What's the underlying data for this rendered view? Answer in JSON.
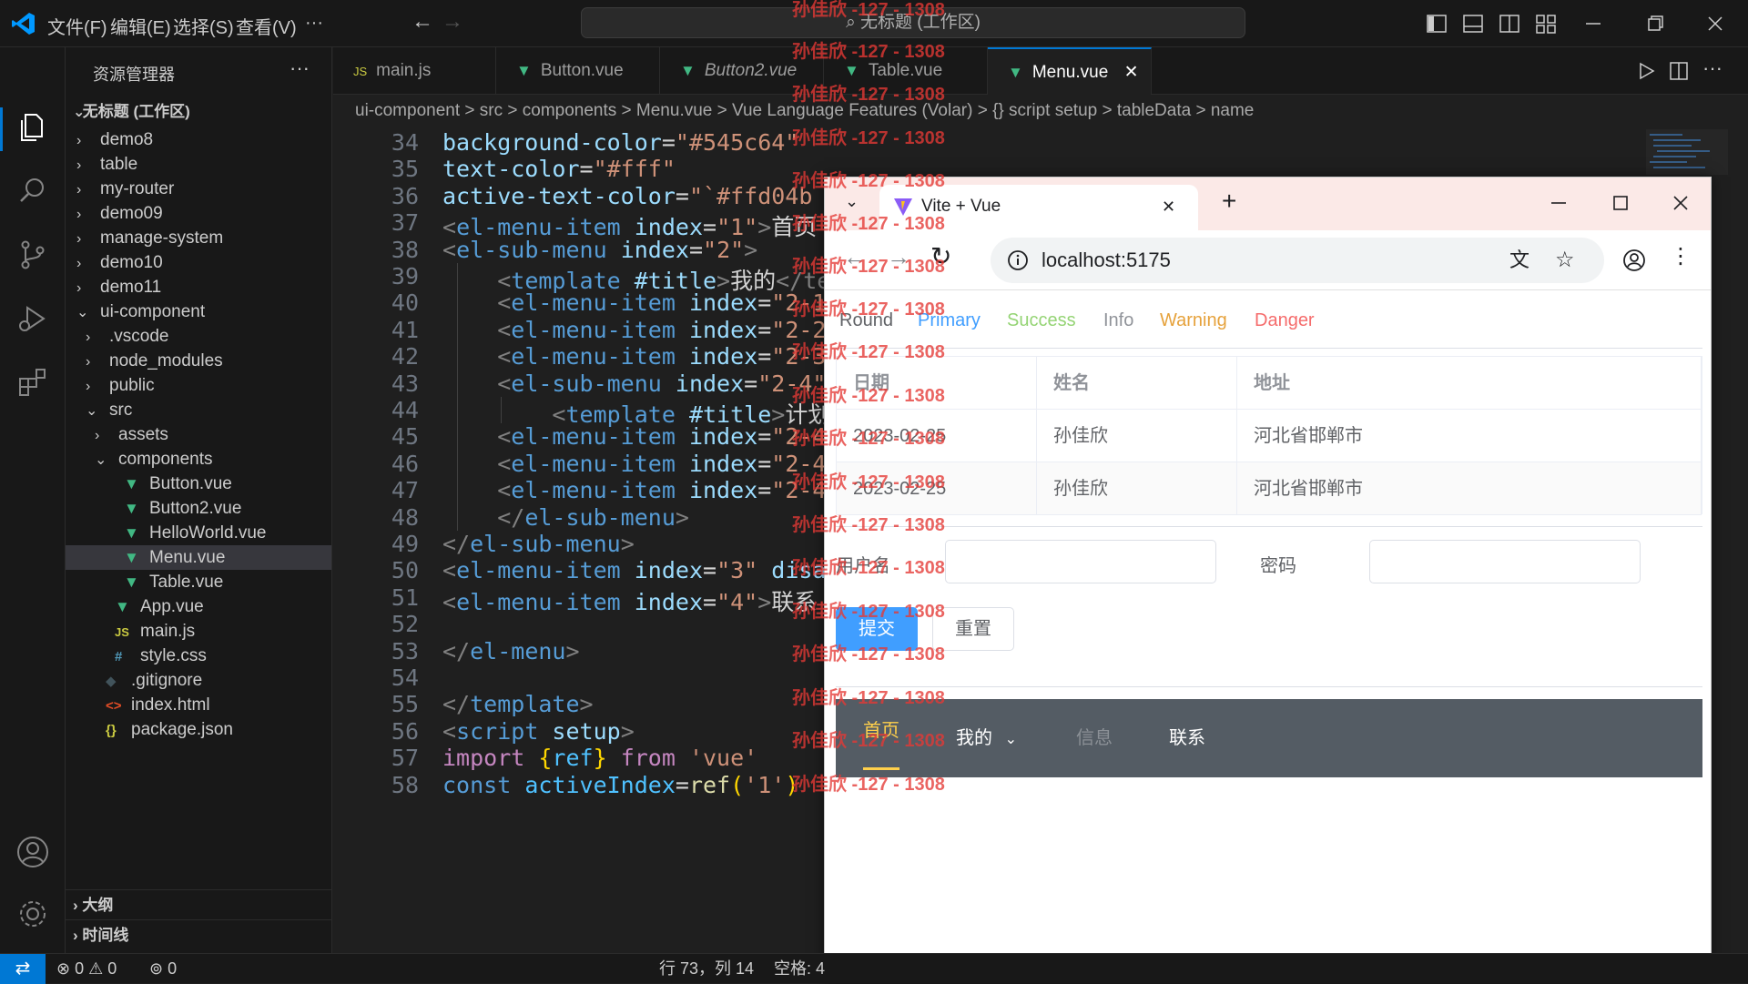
{
  "titlebar": {
    "menus": [
      "文件(F)",
      "编辑(E)",
      "选择(S)",
      "查看(V)",
      "···"
    ],
    "search": "无标题 (工作区)"
  },
  "sidebar": {
    "title": "资源管理器",
    "more": "···",
    "workspace": "无标题 (工作区)",
    "items": [
      {
        "label": "demo8",
        "depth": 0,
        "type": "folder",
        "expanded": false
      },
      {
        "label": "table",
        "depth": 0,
        "type": "folder",
        "expanded": false
      },
      {
        "label": "my-router",
        "depth": 0,
        "type": "folder",
        "expanded": false
      },
      {
        "label": "demo09",
        "depth": 0,
        "type": "folder",
        "expanded": false
      },
      {
        "label": "manage-system",
        "depth": 0,
        "type": "folder",
        "expanded": false
      },
      {
        "label": "demo10",
        "depth": 0,
        "type": "folder",
        "expanded": false
      },
      {
        "label": "demo11",
        "depth": 0,
        "type": "folder",
        "expanded": false
      },
      {
        "label": "ui-component",
        "depth": 0,
        "type": "folder",
        "expanded": true
      },
      {
        "label": ".vscode",
        "depth": 1,
        "type": "folder",
        "expanded": false
      },
      {
        "label": "node_modules",
        "depth": 1,
        "type": "folder",
        "expanded": false
      },
      {
        "label": "public",
        "depth": 1,
        "type": "folder",
        "expanded": false
      },
      {
        "label": "src",
        "depth": 1,
        "type": "folder",
        "expanded": true
      },
      {
        "label": "assets",
        "depth": 2,
        "type": "folder",
        "expanded": false
      },
      {
        "label": "components",
        "depth": 2,
        "type": "folder",
        "expanded": true
      },
      {
        "label": "Button.vue",
        "depth": 3,
        "type": "vue"
      },
      {
        "label": "Button2.vue",
        "depth": 3,
        "type": "vue"
      },
      {
        "label": "HelloWorld.vue",
        "depth": 3,
        "type": "vue"
      },
      {
        "label": "Menu.vue",
        "depth": 3,
        "type": "vue",
        "selected": true
      },
      {
        "label": "Table.vue",
        "depth": 3,
        "type": "vue"
      },
      {
        "label": "App.vue",
        "depth": 2,
        "type": "vue"
      },
      {
        "label": "main.js",
        "depth": 2,
        "type": "js"
      },
      {
        "label": "style.css",
        "depth": 2,
        "type": "css"
      },
      {
        "label": ".gitignore",
        "depth": 1,
        "type": "git"
      },
      {
        "label": "index.html",
        "depth": 1,
        "type": "html"
      },
      {
        "label": "package.json",
        "depth": 1,
        "type": "json"
      }
    ],
    "outline": "大纲",
    "timeline": "时间线"
  },
  "tabs": [
    {
      "label": "main.js",
      "icon": "JS",
      "italic": false,
      "active": false
    },
    {
      "label": "Button.vue",
      "icon": "V",
      "italic": false,
      "active": false
    },
    {
      "label": "Button2.vue",
      "icon": "V",
      "italic": true,
      "active": false
    },
    {
      "label": "Table.vue",
      "icon": "V",
      "italic": false,
      "active": false
    },
    {
      "label": "Menu.vue",
      "icon": "V",
      "italic": false,
      "active": true
    }
  ],
  "breadcrumb": "ui-component > src > components > Menu.vue > Vue Language Features (Volar) > {} script setup > tableData > name",
  "code": {
    "line_numbers": [
      "34",
      "35",
      "36",
      "37",
      "38",
      "39",
      "40",
      "41",
      "42",
      "43",
      "44",
      "45",
      "46",
      "47",
      "48",
      "49",
      "50",
      "51",
      "52",
      "53",
      "54",
      "55",
      "56",
      "57",
      "58"
    ],
    "lines": [
      [
        [
          "background-color",
          "attr"
        ],
        [
          "=",
          "txt"
        ],
        [
          "\"#545c64\"",
          "str"
        ]
      ],
      [
        [
          "text-color",
          "attr"
        ],
        [
          "=",
          "txt"
        ],
        [
          "\"#fff\"",
          "str"
        ]
      ],
      [
        [
          "active-text-color",
          "attr"
        ],
        [
          "=",
          "txt"
        ],
        [
          "\"`#ffd04b",
          "str"
        ]
      ],
      [
        [
          "<",
          "punc"
        ],
        [
          "el-menu-item",
          "tag"
        ],
        [
          " index",
          "attr"
        ],
        [
          "=",
          "txt"
        ],
        [
          "\"1\"",
          "str"
        ],
        [
          ">",
          "punc"
        ],
        [
          "首页",
          "txt"
        ]
      ],
      [
        [
          "<",
          "punc"
        ],
        [
          "el-sub-menu",
          "tag"
        ],
        [
          " index",
          "attr"
        ],
        [
          "=",
          "txt"
        ],
        [
          "\"2\"",
          "str"
        ],
        [
          ">",
          "punc"
        ]
      ],
      [
        [
          "    <",
          "punc"
        ],
        [
          "template",
          "tag"
        ],
        [
          " #title",
          "attr"
        ],
        [
          ">",
          "punc"
        ],
        [
          "我的",
          "txt"
        ],
        [
          "</te",
          "punc"
        ]
      ],
      [
        [
          "    <",
          "punc"
        ],
        [
          "el-menu-item",
          "tag"
        ],
        [
          " index",
          "attr"
        ],
        [
          "=",
          "txt"
        ],
        [
          "\"2-1",
          "str"
        ]
      ],
      [
        [
          "    <",
          "punc"
        ],
        [
          "el-menu-item",
          "tag"
        ],
        [
          " index",
          "attr"
        ],
        [
          "=",
          "txt"
        ],
        [
          "\"2-2",
          "str"
        ]
      ],
      [
        [
          "    <",
          "punc"
        ],
        [
          "el-menu-item",
          "tag"
        ],
        [
          " index",
          "attr"
        ],
        [
          "=",
          "txt"
        ],
        [
          "\"2-3",
          "str"
        ]
      ],
      [
        [
          "    <",
          "punc"
        ],
        [
          "el-sub-menu",
          "tag"
        ],
        [
          " index",
          "attr"
        ],
        [
          "=",
          "txt"
        ],
        [
          "\"2-4\"",
          "str"
        ]
      ],
      [
        [
          "        <",
          "punc"
        ],
        [
          "template",
          "tag"
        ],
        [
          " #title",
          "attr"
        ],
        [
          ">",
          "punc"
        ],
        [
          "计划",
          "txt"
        ]
      ],
      [
        [
          "    <",
          "punc"
        ],
        [
          "el-menu-item",
          "tag"
        ],
        [
          " index",
          "attr"
        ],
        [
          "=",
          "txt"
        ],
        [
          "\"2-4",
          "str"
        ]
      ],
      [
        [
          "    <",
          "punc"
        ],
        [
          "el-menu-item",
          "tag"
        ],
        [
          " index",
          "attr"
        ],
        [
          "=",
          "txt"
        ],
        [
          "\"2-4",
          "str"
        ]
      ],
      [
        [
          "    <",
          "punc"
        ],
        [
          "el-menu-item",
          "tag"
        ],
        [
          " index",
          "attr"
        ],
        [
          "=",
          "txt"
        ],
        [
          "\"2-4",
          "str"
        ]
      ],
      [
        [
          "    </",
          "punc"
        ],
        [
          "el-sub-menu",
          "tag"
        ],
        [
          ">",
          "punc"
        ]
      ],
      [
        [
          "</",
          "punc"
        ],
        [
          "el-sub-menu",
          "tag"
        ],
        [
          ">",
          "punc"
        ]
      ],
      [
        [
          "<",
          "punc"
        ],
        [
          "el-menu-item",
          "tag"
        ],
        [
          " index",
          "attr"
        ],
        [
          "=",
          "txt"
        ],
        [
          "\"3\"",
          "str"
        ],
        [
          " disa",
          "attr"
        ]
      ],
      [
        [
          "<",
          "punc"
        ],
        [
          "el-menu-item",
          "tag"
        ],
        [
          " index",
          "attr"
        ],
        [
          "=",
          "txt"
        ],
        [
          "\"4\"",
          "str"
        ],
        [
          ">",
          "punc"
        ],
        [
          "联系",
          "txt"
        ]
      ],
      [],
      [
        [
          "</",
          "punc"
        ],
        [
          "el-menu",
          "tag"
        ],
        [
          ">",
          "punc"
        ]
      ],
      [],
      [
        [
          "</",
          "punc"
        ],
        [
          "template",
          "tag"
        ],
        [
          ">",
          "punc"
        ]
      ],
      [
        [
          "<",
          "punc"
        ],
        [
          "script",
          "tag"
        ],
        [
          " setup",
          "attr"
        ],
        [
          ">",
          "punc"
        ]
      ],
      [
        [
          "import ",
          "kw"
        ],
        [
          "{",
          "yel"
        ],
        [
          "ref",
          "var"
        ],
        [
          "}",
          "yel"
        ],
        [
          " from ",
          "kw"
        ],
        [
          "'vue'",
          "str"
        ]
      ],
      [
        [
          "const ",
          "tag"
        ],
        [
          "activeIndex",
          "var"
        ],
        [
          "=",
          "txt"
        ],
        [
          "ref",
          "fn"
        ],
        [
          "(",
          "yel"
        ],
        [
          "'1'",
          "str"
        ],
        [
          ")",
          "yel"
        ]
      ]
    ]
  },
  "statusbar": {
    "errors": "0",
    "warnings": "0",
    "ports": "0",
    "position": "行 73，列 14",
    "spaces": "空格: 4"
  },
  "browser": {
    "tab_title": "Vite + Vue",
    "url": "localhost:5175",
    "buttons": [
      "Round",
      "Primary",
      "Success",
      "Info",
      "Warning",
      "Danger"
    ],
    "button_colors": [
      "#606266",
      "#409eff",
      "#95d475",
      "#909399",
      "#e6a23c",
      "#f56c6c"
    ],
    "table": {
      "headers": [
        "日期",
        "姓名",
        "地址"
      ],
      "rows": [
        [
          "2023-02-25",
          "孙佳欣",
          "河北省邯郸市"
        ],
        [
          "2023-02-25",
          "孙佳欣",
          "河北省邯郸市"
        ]
      ]
    },
    "form": {
      "username_label": "用户名",
      "password_label": "密码",
      "submit": "提交",
      "reset": "重置"
    },
    "menu": {
      "items": [
        "首页",
        "我的",
        "信息",
        "联系"
      ],
      "bg": "#545c64"
    }
  },
  "watermark": "孙佳欣 -127 - 1308"
}
